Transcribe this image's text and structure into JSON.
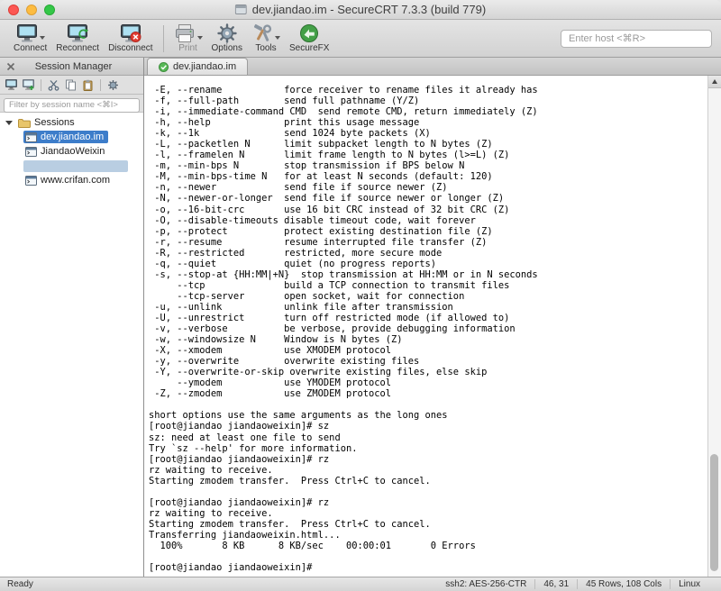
{
  "titlebar": {
    "title": "dev.jiandao.im - SecureCRT 7.3.3 (build 779)"
  },
  "toolbar": {
    "buttons": [
      {
        "label": "Connect"
      },
      {
        "label": "Reconnect"
      },
      {
        "label": "Disconnect"
      },
      {
        "label": "Print"
      },
      {
        "label": "Options"
      },
      {
        "label": "Tools"
      },
      {
        "label": "SecureFX"
      }
    ],
    "host_input_placeholder": "Enter host <⌘R>"
  },
  "session_manager": {
    "title": "Session Manager",
    "filter_placeholder": "Filter by session name <⌘I>",
    "tree": {
      "root_label": "Sessions",
      "items": [
        {
          "label": "dev.jiandao.im",
          "selected": true
        },
        {
          "label": "JiandaoWeixin",
          "selected": false
        },
        {
          "label": "",
          "selected": false,
          "highlighted": true
        },
        {
          "label": "www.crifan.com",
          "selected": false
        }
      ]
    }
  },
  "tab": {
    "label": "dev.jiandao.im"
  },
  "terminal": {
    "lines": [
      " -E, --rename           force receiver to rename files it already has",
      " -f, --full-path        send full pathname (Y/Z)",
      " -i, --immediate-command CMD  send remote CMD, return immediately (Z)",
      " -h, --help             print this usage message",
      " -k, --1k               send 1024 byte packets (X)",
      " -L, --packetlen N      limit subpacket length to N bytes (Z)",
      " -l, --framelen N       limit frame length to N bytes (l>=L) (Z)",
      " -m, --min-bps N        stop transmission if BPS below N",
      " -M, --min-bps-time N   for at least N seconds (default: 120)",
      " -n, --newer            send file if source newer (Z)",
      " -N, --newer-or-longer  send file if source newer or longer (Z)",
      " -o, --16-bit-crc       use 16 bit CRC instead of 32 bit CRC (Z)",
      " -O, --disable-timeouts disable timeout code, wait forever",
      " -p, --protect          protect existing destination file (Z)",
      " -r, --resume           resume interrupted file transfer (Z)",
      " -R, --restricted       restricted, more secure mode",
      " -q, --quiet            quiet (no progress reports)",
      " -s, --stop-at {HH:MM|+N}  stop transmission at HH:MM or in N seconds",
      "     --tcp              build a TCP connection to transmit files",
      "     --tcp-server       open socket, wait for connection",
      " -u, --unlink           unlink file after transmission",
      " -U, --unrestrict       turn off restricted mode (if allowed to)",
      " -v, --verbose          be verbose, provide debugging information",
      " -w, --windowsize N     Window is N bytes (Z)",
      " -X, --xmodem           use XMODEM protocol",
      " -y, --overwrite        overwrite existing files",
      " -Y, --overwrite-or-skip overwrite existing files, else skip",
      "     --ymodem           use YMODEM protocol",
      " -Z, --zmodem           use ZMODEM protocol",
      "",
      "short options use the same arguments as the long ones",
      "[root@jiandao jiandaoweixin]# sz",
      "sz: need at least one file to send",
      "Try `sz --help' for more information.",
      "[root@jiandao jiandaoweixin]# rz",
      "rz waiting to receive.",
      "Starting zmodem transfer.  Press Ctrl+C to cancel.",
      "",
      "[root@jiandao jiandaoweixin]# rz",
      "rz waiting to receive.",
      "Starting zmodem transfer.  Press Ctrl+C to cancel.",
      "Transferring jiandaoweixin.html...",
      "  100%       8 KB      8 KB/sec    00:00:01       0 Errors",
      "",
      "[root@jiandao jiandaoweixin]# "
    ]
  },
  "status_bar": {
    "ready": "Ready",
    "protocol": "ssh2: AES-256-CTR",
    "cursor_position": "46, 31",
    "terminal_size": "45 Rows, 108 Cols",
    "remote_os": "Linux"
  },
  "icons": {
    "titlebar": [
      "close-button",
      "minimize-button",
      "zoom-button",
      "app-icon"
    ],
    "toolbar": [
      "monitor-connect-icon",
      "chevron-down-icon",
      "monitor-reconnect-icon",
      "monitor-disconnect-icon",
      "printer-icon",
      "gear-icon",
      "tools-icon",
      "securefx-icon"
    ],
    "session_manager": [
      "close-icon",
      "connect-session-icon",
      "new-session-icon",
      "cut-icon",
      "copy-icon",
      "paste-icon",
      "properties-icon",
      "disclosure-triangle-icon",
      "folder-icon",
      "session-terminal-icon"
    ],
    "tab": [
      "connected-check-icon"
    ],
    "scrollbar": [
      "scroll-up-arrow-icon"
    ]
  }
}
